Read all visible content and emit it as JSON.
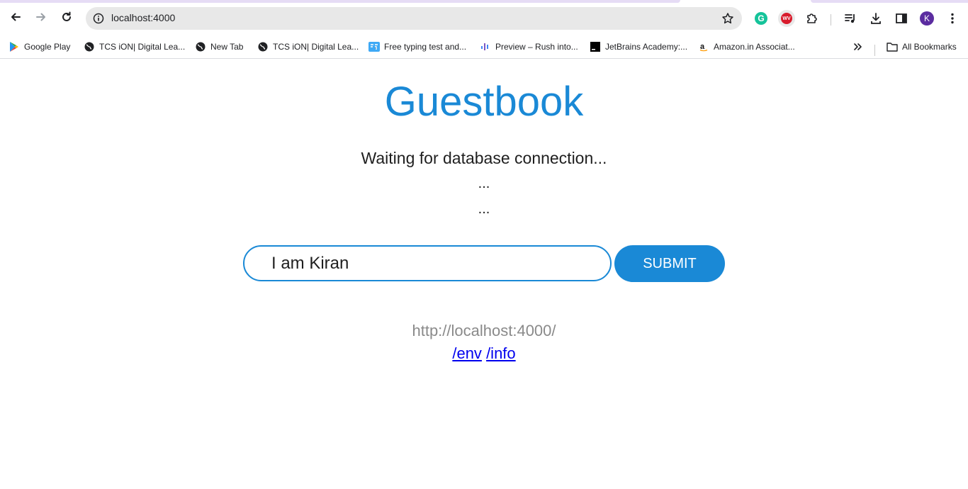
{
  "browser": {
    "url": "localhost:4000",
    "profile_initial": "K",
    "grammarly_letter": "G",
    "wv_label": "WV",
    "accent_color": "#1a73e8"
  },
  "bookmarks": {
    "items": [
      {
        "label": "Google Play",
        "icon": "google-play-icon"
      },
      {
        "label": "TCS iON| Digital Lea...",
        "icon": "globe-icon"
      },
      {
        "label": "New Tab",
        "icon": "globe-icon"
      },
      {
        "label": "TCS iON| Digital Lea...",
        "icon": "globe-icon"
      },
      {
        "label": "Free typing test and...",
        "icon": "typing-icon"
      },
      {
        "label": "Preview – Rush into...",
        "icon": "preview-icon"
      },
      {
        "label": "JetBrains Academy:...",
        "icon": "jetbrains-icon"
      },
      {
        "label": "Amazon.in Associat...",
        "icon": "amazon-icon"
      }
    ],
    "all_bookmarks_label": "All Bookmarks"
  },
  "page": {
    "title": "Guestbook",
    "status": "Waiting for database connection...",
    "dots_1": "...",
    "dots_2": "...",
    "input_value": "I am Kiran",
    "submit_label": "SUBMIT",
    "host": "http://localhost:4000/",
    "link_env": "/env",
    "link_info": "/info",
    "primary_color": "#1a89d6"
  }
}
